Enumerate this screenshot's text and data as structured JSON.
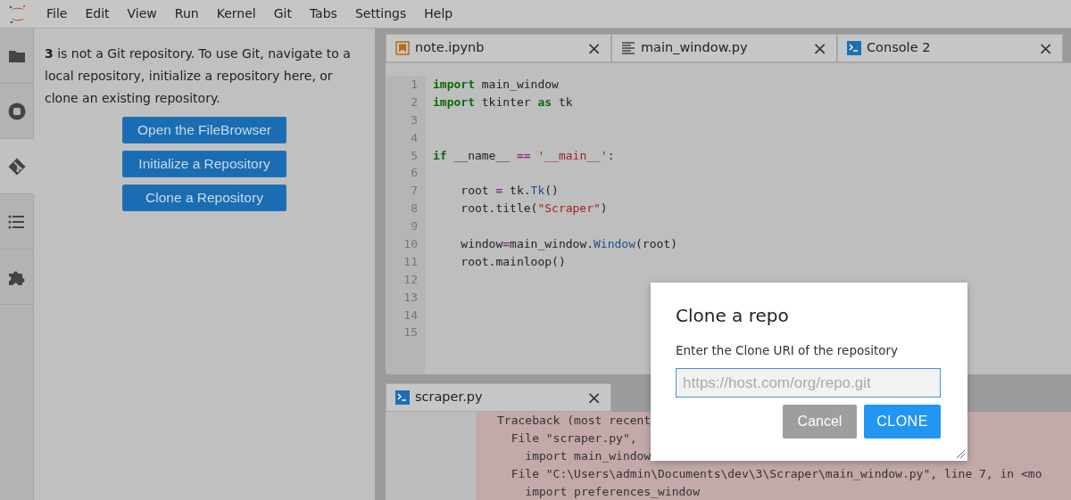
{
  "menu_bar": {
    "items": [
      "File",
      "Edit",
      "View",
      "Run",
      "Kernel",
      "Git",
      "Tabs",
      "Settings",
      "Help"
    ]
  },
  "left_sidebar": {
    "tabs": [
      {
        "kind": "folder",
        "selected": false
      },
      {
        "kind": "stop",
        "selected": false
      },
      {
        "kind": "git",
        "selected": true
      },
      {
        "kind": "list",
        "selected": false
      },
      {
        "kind": "puzzle",
        "selected": false
      }
    ]
  },
  "git_panel": {
    "message": "**3** is not a Git repository. To use Git, navigate to a local repository, initialize a repository here, or clone an existing repository.",
    "buttons": [
      "Open the FileBrowser",
      "Initialize a Repository",
      "Clone a Repository"
    ]
  },
  "editor_tabs": [
    {
      "kind": "notebook",
      "label": "note.ipynb",
      "close": "×"
    },
    {
      "kind": "file",
      "label": "main_window.py",
      "close": "×"
    },
    {
      "kind": "console",
      "label": "Console 2",
      "close": "×"
    }
  ],
  "editor": {
    "lines": [
      {
        "number": "1",
        "tokens": [
          {
            "kind": "keyword",
            "text": "import"
          },
          {
            "kind": "plain",
            "text": " main_window"
          }
        ]
      },
      {
        "number": "2",
        "tokens": [
          {
            "kind": "keyword",
            "text": "import"
          },
          {
            "kind": "plain",
            "text": " tkinter "
          },
          {
            "kind": "keyword",
            "text": "as"
          },
          {
            "kind": "plain",
            "text": " tk"
          }
        ]
      },
      {
        "number": "3"
      },
      {
        "number": "4"
      },
      {
        "number": "5",
        "tokens": [
          {
            "kind": "keyword",
            "text": "if"
          },
          {
            "kind": "plain",
            "text": " __name__ "
          },
          {
            "kind": "operator",
            "text": "=="
          },
          {
            "kind": "string",
            "text": " '__main__'"
          },
          {
            "kind": "plain",
            "text": ":"
          }
        ]
      },
      {
        "number": "6"
      },
      {
        "number": "7",
        "tokens": [
          {
            "kind": "plain",
            "text": "    root "
          },
          {
            "kind": "operator",
            "text": "="
          },
          {
            "kind": "plain",
            "text": " tk."
          },
          {
            "kind": "name",
            "text": "Tk"
          },
          {
            "kind": "plain",
            "text": "()"
          }
        ]
      },
      {
        "number": "8",
        "tokens": [
          {
            "kind": "plain",
            "text": "    root.title("
          },
          {
            "kind": "string",
            "text": "\"Scraper\""
          },
          {
            "kind": "plain",
            "text": ")"
          }
        ]
      },
      {
        "number": "9"
      },
      {
        "number": "10",
        "tokens": [
          {
            "kind": "plain",
            "text": "    window"
          },
          {
            "kind": "operator",
            "text": "="
          },
          {
            "kind": "plain",
            "text": "main_window."
          },
          {
            "kind": "name",
            "text": "Window"
          },
          {
            "kind": "plain",
            "text": "(root)"
          }
        ]
      },
      {
        "number": "11",
        "tokens": [
          {
            "kind": "plain",
            "text": "    root.mainloop()"
          }
        ]
      },
      {
        "number": "12"
      },
      {
        "number": "13"
      },
      {
        "number": "14"
      },
      {
        "number": "15"
      }
    ]
  },
  "bottom_panel": {
    "tab": {
      "kind": "console",
      "label": "scraper.py",
      "close": "×"
    },
    "output": [
      "Traceback (most recent",
      "  File \"scraper.py\",",
      "    import main_window",
      "  File \"C:\\Users\\admin\\Documents\\dev\\3\\Scraper\\main_window.py\", line 7, in <mo",
      "    import preferences_window"
    ]
  },
  "dialog": {
    "title": "Clone a repo",
    "label": "Enter the Clone URI of the repository",
    "placeholder": "https://host.com/org/repo.git",
    "buttons": [
      {
        "kind": "secondary",
        "label": "Cancel"
      },
      {
        "kind": "primary",
        "label": "CLONE"
      }
    ]
  }
}
